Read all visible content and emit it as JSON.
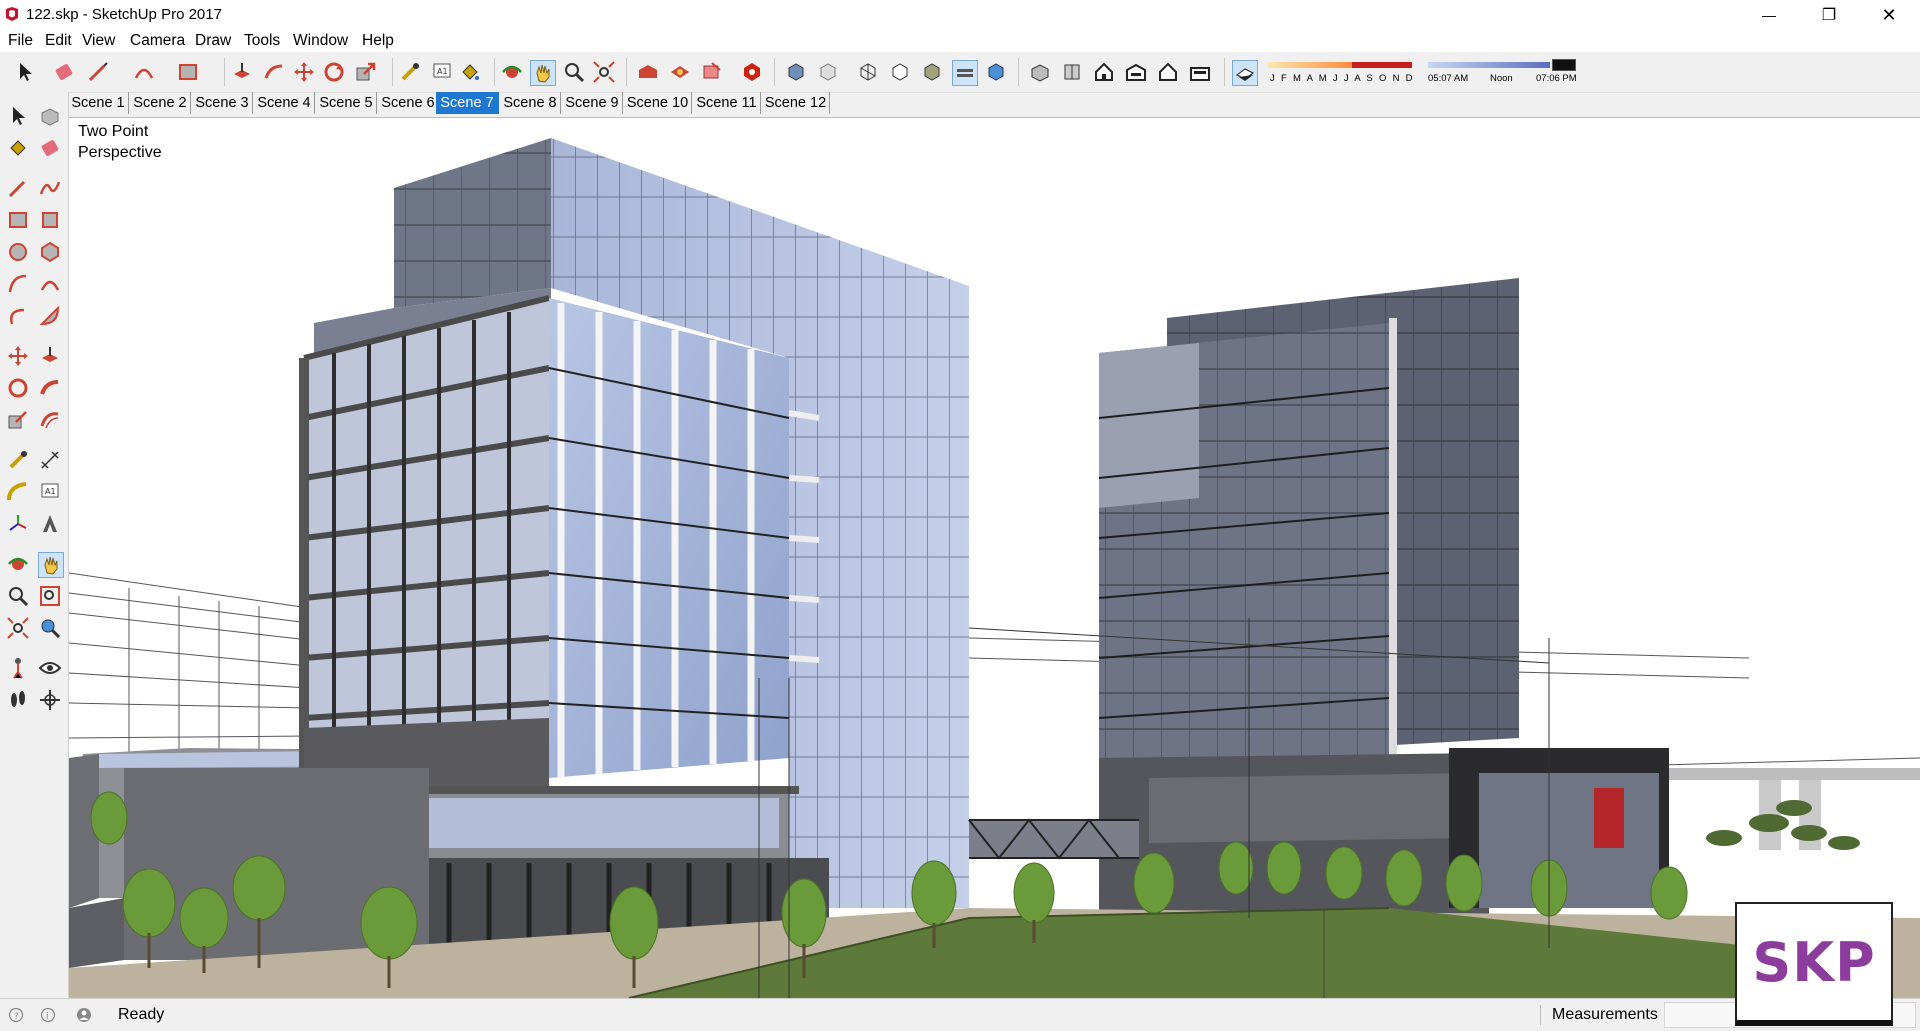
{
  "window": {
    "title": "122.skp - SketchUp Pro 2017",
    "minimize_glyph": "—",
    "restore_glyph": "❐",
    "close_glyph": "✕"
  },
  "menu": {
    "items": [
      {
        "label": "File"
      },
      {
        "label": "Edit"
      },
      {
        "label": "View"
      },
      {
        "label": "Camera"
      },
      {
        "label": "Draw"
      },
      {
        "label": "Tools"
      },
      {
        "label": "Window"
      },
      {
        "label": "Help"
      }
    ]
  },
  "toolbar": {
    "shadow_months": "J F M A M J J A S O N D",
    "time_start": "05:07 AM",
    "time_noon": "Noon",
    "time_end": "07:06 PM"
  },
  "scenes": {
    "tabs": [
      {
        "label": "Scene 1"
      },
      {
        "label": "Scene 2"
      },
      {
        "label": "Scene 3"
      },
      {
        "label": "Scene 4"
      },
      {
        "label": "Scene 5"
      },
      {
        "label": "Scene 6"
      },
      {
        "label": "Scene 7"
      },
      {
        "label": "Scene 8"
      },
      {
        "label": "Scene 9"
      },
      {
        "label": "Scene 10"
      },
      {
        "label": "Scene 11"
      },
      {
        "label": "Scene 12"
      }
    ],
    "active": "Scene 7"
  },
  "viewport": {
    "camera_label_line1": "Two Point",
    "camera_label_line2": "Perspective"
  },
  "status": {
    "text": "Ready",
    "measurements_label": "Measurements",
    "measurements_value": ""
  },
  "watermark": {
    "text": "SKP"
  },
  "colors": {
    "accent": "#1e78d2",
    "badge_purple": "#8c3c9c",
    "glass": "#9fb3d6",
    "grass": "#5f7a3c"
  }
}
